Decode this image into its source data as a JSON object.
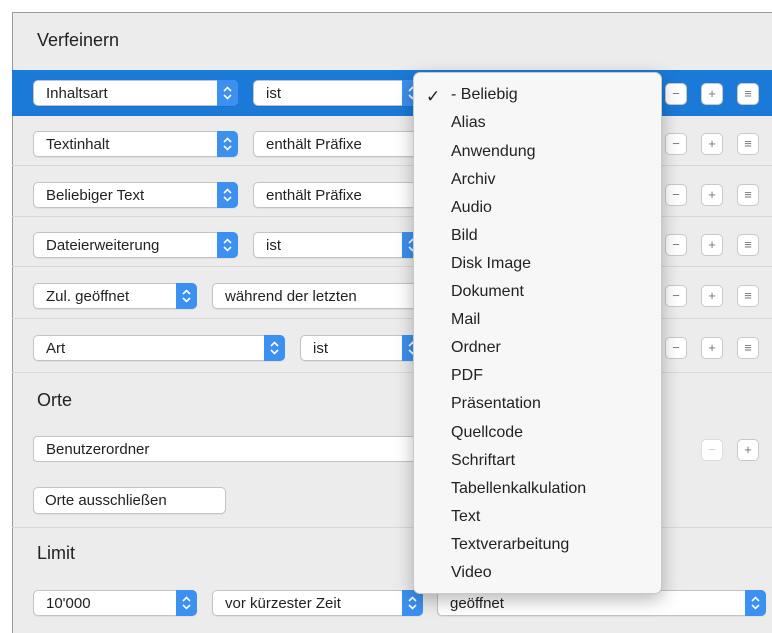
{
  "sections": {
    "refine": "Verfeinern",
    "places": "Orte",
    "limit": "Limit"
  },
  "rules": [
    {
      "attribute": "Inhaltsart",
      "operator": "ist",
      "selected": true
    },
    {
      "attribute": "Textinhalt",
      "operator": "enthält Präfixe"
    },
    {
      "attribute": "Beliebiger Text",
      "operator": "enthält Präfixe"
    },
    {
      "attribute": "Dateierweiterung",
      "operator": "ist"
    },
    {
      "attribute": "Zul. geöffnet",
      "operator": "während der letzten"
    },
    {
      "attribute": "Art",
      "operator": "ist"
    }
  ],
  "row_buttons": {
    "remove": "−",
    "add": "+",
    "more": "≡"
  },
  "places": {
    "folder": "Benutzerordner",
    "exclude_button": "Orte ausschließen"
  },
  "limit": {
    "count": "10'000",
    "order": "vor kürzester Zeit",
    "field": "geöffnet"
  },
  "menu": {
    "checkmark": "✓",
    "items": [
      "- Beliebig",
      "Alias",
      "Anwendung",
      "Archiv",
      "Audio",
      "Bild",
      "Disk Image",
      "Dokument",
      "Mail",
      "Ordner",
      "PDF",
      "Präsentation",
      "Quellcode",
      "Schriftart",
      "Tabellenkalkulation",
      "Text",
      "Textverarbeitung",
      "Video"
    ],
    "selected_index": 0
  },
  "colors": {
    "selection": "#1b7ad7",
    "popup_arrow": "#3c90f0",
    "panel": "#ececec"
  }
}
